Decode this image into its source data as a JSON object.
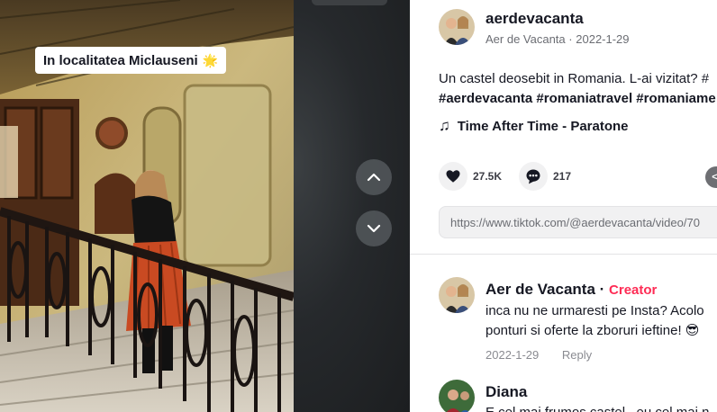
{
  "video": {
    "sticker_text": "In localitatea Miclauseni",
    "sticker_emoji": "🌟"
  },
  "post": {
    "username": "aerdevacanta",
    "display_name": "Aer de Vacanta",
    "separator": "·",
    "date": "2022-1-29",
    "description_line1": "Un castel deosebit in Romania. L-ai vizitat? #",
    "description_line2": "#aerdevacanta #romaniatravel #romaniame",
    "music_note": "♫",
    "music": "Time After Time - Paratone",
    "likes": "27.5K",
    "comments": "217",
    "embed_label": "</",
    "link": "https://www.tiktok.com/@aerdevacanta/video/70"
  },
  "comments": [
    {
      "author": "Aer de Vacanta",
      "dot": "·",
      "badge": "Creator",
      "text_line1": "inca nu ne urmaresti pe Insta? Acolo",
      "text_line2": "ponturi si oferte la zboruri ieftine! 😎",
      "date": "2022-1-29",
      "reply_label": "Reply"
    },
    {
      "author": "Diana",
      "text_line1": "E cel mai frumos castel , eu cel mai n"
    }
  ],
  "colors": {
    "creator_badge": "#fe2c55",
    "text_primary": "#161823",
    "text_secondary": "#6b6d73"
  },
  "icons": {
    "nav_up": "chevron-up-icon",
    "nav_down": "chevron-down-icon",
    "like": "heart-icon",
    "comment": "comment-icon",
    "music": "music-note-icon",
    "embed": "embed-code-icon"
  }
}
